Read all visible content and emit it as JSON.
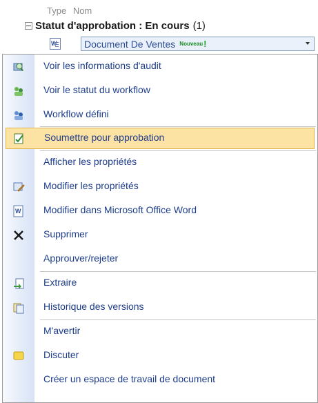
{
  "list": {
    "column_headers": [
      "Type",
      "Nom"
    ],
    "group_label": "Statut d'approbation : En cours",
    "group_count": "(1)",
    "document_title": "Document De Ventes",
    "new_badge": "Nouveau",
    "new_exclamation": "!"
  },
  "menu": {
    "items": [
      {
        "label": "Voir les informations d'audit",
        "icon": "audit-icon"
      },
      {
        "label": "Voir le statut du workflow",
        "icon": "workflow-status-icon"
      },
      {
        "label": "Workflow défini",
        "icon": "workflow-defined-icon"
      },
      {
        "label": "Soumettre pour approbation",
        "icon": "submit-approval-icon",
        "highlighted": true
      },
      {
        "label": "Afficher les propriétés",
        "icon": ""
      },
      {
        "label": "Modifier les propriétés",
        "icon": "edit-properties-icon"
      },
      {
        "label": "Modifier dans Microsoft Office Word",
        "icon": "word-icon"
      },
      {
        "label": "Supprimer",
        "icon": "delete-icon"
      },
      {
        "label": "Approuver/rejeter",
        "icon": ""
      },
      {
        "label": "Extraire",
        "icon": "checkout-icon"
      },
      {
        "label": "Historique des versions",
        "icon": "version-history-icon"
      },
      {
        "label": "M'avertir",
        "icon": ""
      },
      {
        "label": "Discuter",
        "icon": "discuss-icon"
      },
      {
        "label": "Créer un espace de travail de document",
        "icon": ""
      }
    ]
  },
  "colors": {
    "menu_text": "#1d3c8a",
    "highlight_bg": "#fce3a3",
    "highlight_border": "#e1b34b",
    "gutter": "#d7e3f6",
    "new_badge": "#1d8a24"
  }
}
